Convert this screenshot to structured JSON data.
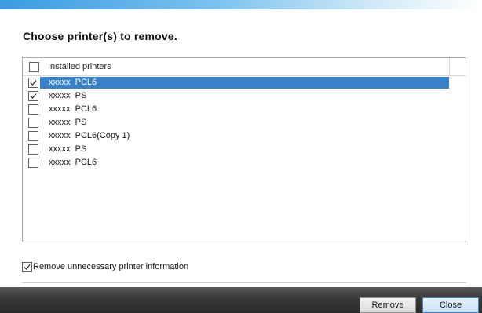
{
  "dialog": {
    "heading": "Choose printer(s) to remove."
  },
  "list": {
    "header_label": "Installed printers",
    "header_checked": false,
    "items": [
      {
        "name": "xxxxx  PCL6",
        "checked": true,
        "selected": true
      },
      {
        "name": "xxxxx  PS",
        "checked": true,
        "selected": false
      },
      {
        "name": "xxxxx  PCL6",
        "checked": false,
        "selected": false
      },
      {
        "name": "xxxxx  PS",
        "checked": false,
        "selected": false
      },
      {
        "name": "xxxxx  PCL6(Copy 1)",
        "checked": false,
        "selected": false
      },
      {
        "name": "xxxxx  PS",
        "checked": false,
        "selected": false
      },
      {
        "name": "xxxxx  PCL6",
        "checked": false,
        "selected": false
      }
    ]
  },
  "options": {
    "remove_info_label": "Remove unnecessary printer information",
    "remove_info_checked": true
  },
  "buttons": {
    "remove_label": "Remove",
    "close_label": "Close"
  },
  "colors": {
    "selection": "#3880c9",
    "title_accent": "#3b9be0"
  }
}
